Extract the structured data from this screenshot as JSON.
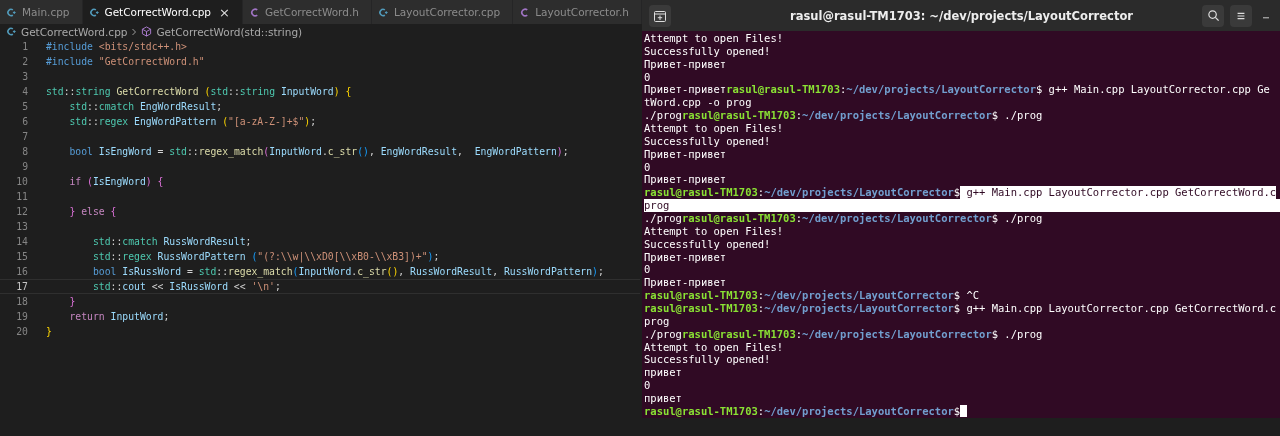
{
  "editor": {
    "tabs": [
      {
        "label": "Main.cpp",
        "kind": "cpp",
        "selected": false
      },
      {
        "label": "GetCorrectWord.cpp",
        "kind": "cpp",
        "selected": true,
        "close": "×"
      },
      {
        "label": "GetCorrectWord.h",
        "kind": "h",
        "selected": false
      },
      {
        "label": "LayoutCorrector.cpp",
        "kind": "cpp",
        "selected": false
      },
      {
        "label": "LayoutCorrector.h",
        "kind": "h",
        "selected": false
      }
    ],
    "breadcrumb": [
      {
        "label": "GetCorrectWord.cpp",
        "kind": "cpp"
      },
      {
        "label": "GetCorrectWord(std::string)",
        "kind": "method"
      }
    ],
    "lines": [
      {
        "n": "1",
        "current": false,
        "tokens": [
          {
            "kind": "pre",
            "text": "#include "
          },
          {
            "kind": "str",
            "text": "<bits/stdc++.h>"
          }
        ]
      },
      {
        "n": "2",
        "current": false,
        "tokens": [
          {
            "kind": "pre",
            "text": "#include "
          },
          {
            "kind": "str",
            "text": "\"GetCorrectWord.h\""
          }
        ]
      },
      {
        "n": "3",
        "current": false
      },
      {
        "n": "4",
        "current": false,
        "tokens": [
          {
            "kind": "type",
            "text": "std"
          },
          {
            "kind": "plain",
            "text": "::"
          },
          {
            "kind": "type",
            "text": "string "
          },
          {
            "kind": "fn",
            "text": "GetCorrectWord "
          },
          {
            "kind": "b1",
            "text": "("
          },
          {
            "kind": "type",
            "text": "std"
          },
          {
            "kind": "plain",
            "text": "::"
          },
          {
            "kind": "type",
            "text": "string "
          },
          {
            "kind": "var",
            "text": "InputWord"
          },
          {
            "kind": "b1",
            "text": ") {"
          }
        ]
      },
      {
        "n": "5",
        "current": false,
        "tokens": [
          {
            "kind": "type",
            "text": "    std"
          },
          {
            "kind": "plain",
            "text": "::"
          },
          {
            "kind": "type",
            "text": "cmatch "
          },
          {
            "kind": "var",
            "text": "EngWordResult"
          },
          {
            "kind": "plain",
            "text": ";"
          }
        ]
      },
      {
        "n": "6",
        "current": false,
        "tokens": [
          {
            "kind": "type",
            "text": "    std"
          },
          {
            "kind": "plain",
            "text": "::"
          },
          {
            "kind": "type",
            "text": "regex "
          },
          {
            "kind": "var",
            "text": "EngWordPattern "
          },
          {
            "kind": "b1",
            "text": "("
          },
          {
            "kind": "str",
            "text": "\"[a-zA-Z-]+$\""
          },
          {
            "kind": "b1",
            "text": ")"
          },
          {
            "kind": "plain",
            "text": ";"
          }
        ]
      },
      {
        "n": "7",
        "current": false
      },
      {
        "n": "8",
        "current": false,
        "tokens": [
          {
            "kind": "kw",
            "text": "    bool "
          },
          {
            "kind": "var",
            "text": "IsEngWord"
          },
          {
            "kind": "plain",
            "text": " = "
          },
          {
            "kind": "type",
            "text": "std"
          },
          {
            "kind": "plain",
            "text": "::"
          },
          {
            "kind": "fn",
            "text": "regex_match"
          },
          {
            "kind": "b2",
            "text": "("
          },
          {
            "kind": "var",
            "text": "InputWord"
          },
          {
            "kind": "plain",
            "text": "."
          },
          {
            "kind": "fn",
            "text": "c_str"
          },
          {
            "kind": "b3",
            "text": "()"
          },
          {
            "kind": "plain",
            "text": ", "
          },
          {
            "kind": "var",
            "text": "EngWordResult"
          },
          {
            "kind": "plain",
            "text": ",  "
          },
          {
            "kind": "var",
            "text": "EngWordPattern"
          },
          {
            "kind": "b2",
            "text": ")"
          },
          {
            "kind": "plain",
            "text": ";"
          }
        ]
      },
      {
        "n": "9",
        "current": false
      },
      {
        "n": "10",
        "current": false,
        "tokens": [
          {
            "kind": "ctl",
            "text": "    if "
          },
          {
            "kind": "b2",
            "text": "("
          },
          {
            "kind": "var",
            "text": "IsEngWord"
          },
          {
            "kind": "b2",
            "text": ") {"
          }
        ]
      },
      {
        "n": "11",
        "current": false
      },
      {
        "n": "12",
        "current": false,
        "tokens": [
          {
            "kind": "b2",
            "text": "    } "
          },
          {
            "kind": "ctl",
            "text": "else "
          },
          {
            "kind": "b2m",
            "text": "{"
          }
        ]
      },
      {
        "n": "13",
        "current": false
      },
      {
        "n": "14",
        "current": false,
        "tokens": [
          {
            "kind": "type",
            "text": "        std"
          },
          {
            "kind": "plain",
            "text": "::"
          },
          {
            "kind": "type",
            "text": "cmatch "
          },
          {
            "kind": "var",
            "text": "RussWordResult"
          },
          {
            "kind": "plain",
            "text": ";"
          }
        ]
      },
      {
        "n": "15",
        "current": false,
        "tokens": [
          {
            "kind": "type",
            "text": "        std"
          },
          {
            "kind": "plain",
            "text": "::"
          },
          {
            "kind": "type",
            "text": "regex "
          },
          {
            "kind": "var",
            "text": "RussWordPattern "
          },
          {
            "kind": "b3",
            "text": "("
          },
          {
            "kind": "str",
            "text": "\"(?:\\\\w|\\\\xD0[\\\\xB0-\\\\xB3])+\""
          },
          {
            "kind": "b3",
            "text": ")"
          },
          {
            "kind": "plain",
            "text": ";"
          }
        ]
      },
      {
        "n": "16",
        "current": false,
        "tokens": [
          {
            "kind": "kw",
            "text": "        bool "
          },
          {
            "kind": "var",
            "text": "IsRussWord"
          },
          {
            "kind": "plain",
            "text": " = "
          },
          {
            "kind": "type",
            "text": "std"
          },
          {
            "kind": "plain",
            "text": "::"
          },
          {
            "kind": "fn",
            "text": "regex_match"
          },
          {
            "kind": "b3",
            "text": "("
          },
          {
            "kind": "var",
            "text": "InputWord"
          },
          {
            "kind": "plain",
            "text": "."
          },
          {
            "kind": "fn",
            "text": "c_str"
          },
          {
            "kind": "b1",
            "text": "()"
          },
          {
            "kind": "plain",
            "text": ", "
          },
          {
            "kind": "var",
            "text": "RussWordResult"
          },
          {
            "kind": "plain",
            "text": ", "
          },
          {
            "kind": "var",
            "text": "RussWordPattern"
          },
          {
            "kind": "b3",
            "text": ")"
          },
          {
            "kind": "plain",
            "text": ";"
          }
        ]
      },
      {
        "n": "17",
        "current": true,
        "tokens": [
          {
            "kind": "type",
            "text": "        std"
          },
          {
            "kind": "plain",
            "text": "::"
          },
          {
            "kind": "var",
            "text": "cout"
          },
          {
            "kind": "plain",
            "text": " << "
          },
          {
            "kind": "var",
            "text": "IsRussWord"
          },
          {
            "kind": "plain",
            "text": " << "
          },
          {
            "kind": "str",
            "text": "'\\n'"
          },
          {
            "kind": "plain",
            "text": ";"
          }
        ]
      },
      {
        "n": "18",
        "current": false,
        "tokens": [
          {
            "kind": "b2m",
            "text": "    }"
          }
        ]
      },
      {
        "n": "19",
        "current": false,
        "tokens": [
          {
            "kind": "ctl",
            "text": "    return "
          },
          {
            "kind": "var",
            "text": "InputWord"
          },
          {
            "kind": "plain",
            "text": ";"
          }
        ]
      },
      {
        "n": "20",
        "current": false,
        "tokens": [
          {
            "kind": "b1",
            "text": "}"
          }
        ]
      }
    ]
  },
  "terminal": {
    "title": "rasul@rasul-TM1703: ~/dev/projects/LayoutCorrector",
    "lines": [
      {
        "selected": false,
        "segments": [
          {
            "kind": "out",
            "text": "Attempt to open Files!"
          }
        ]
      },
      {
        "selected": false,
        "segments": [
          {
            "kind": "out",
            "text": "Successfully opened!"
          }
        ]
      },
      {
        "selected": false,
        "segments": [
          {
            "kind": "out",
            "text": "Привет-привет"
          }
        ]
      },
      {
        "selected": false,
        "segments": [
          {
            "kind": "out",
            "text": "0"
          }
        ]
      },
      {
        "selected": false,
        "segments": [
          {
            "kind": "out",
            "text": "Привет-привет"
          },
          {
            "kind": "user",
            "text": "rasul@rasul-TM1703"
          },
          {
            "kind": "out",
            "text": ":"
          },
          {
            "kind": "path",
            "text": "~/dev/projects/LayoutCorrector"
          },
          {
            "kind": "out",
            "text": "$ g++ Main.cpp LayoutCorrector.cpp Ge"
          }
        ]
      },
      {
        "selected": false,
        "segments": [
          {
            "kind": "out",
            "text": "tWord.cpp -o prog"
          }
        ]
      },
      {
        "selected": false,
        "segments": [
          {
            "kind": "out",
            "text": "./prog"
          },
          {
            "kind": "user",
            "text": "rasul@rasul-TM1703"
          },
          {
            "kind": "out",
            "text": ":"
          },
          {
            "kind": "path",
            "text": "~/dev/projects/LayoutCorrector"
          },
          {
            "kind": "out",
            "text": "$ ./prog"
          }
        ]
      },
      {
        "selected": false,
        "segments": [
          {
            "kind": "out",
            "text": "Attempt to open Files!"
          }
        ]
      },
      {
        "selected": false,
        "segments": [
          {
            "kind": "out",
            "text": "Successfully opened!"
          }
        ]
      },
      {
        "selected": false,
        "segments": [
          {
            "kind": "out",
            "text": "Привет-привет"
          }
        ]
      },
      {
        "selected": false,
        "segments": [
          {
            "kind": "out",
            "text": "0"
          }
        ]
      },
      {
        "selected": false,
        "segments": [
          {
            "kind": "out",
            "text": "Привет-привет"
          }
        ]
      },
      {
        "selected": false,
        "segments": [
          {
            "kind": "user",
            "text": "rasul@rasul-TM1703"
          },
          {
            "kind": "out",
            "text": ":"
          },
          {
            "kind": "path",
            "text": "~/dev/projects/LayoutCorrector"
          },
          {
            "kind": "out",
            "text": "$"
          },
          {
            "kind": "sel",
            "text": " g++ Main.cpp LayoutCorrector.cpp GetCorrectWord.c"
          }
        ]
      },
      {
        "selected": true,
        "segments": [
          {
            "kind": "out",
            "text": "prog"
          }
        ]
      },
      {
        "selected": false,
        "segments": [
          {
            "kind": "out",
            "text": "./prog"
          },
          {
            "kind": "user",
            "text": "rasul@rasul-TM1703"
          },
          {
            "kind": "out",
            "text": ":"
          },
          {
            "kind": "path",
            "text": "~/dev/projects/LayoutCorrector"
          },
          {
            "kind": "out",
            "text": "$ ./prog"
          }
        ]
      },
      {
        "selected": false,
        "segments": [
          {
            "kind": "out",
            "text": "Attempt to open Files!"
          }
        ]
      },
      {
        "selected": false,
        "segments": [
          {
            "kind": "out",
            "text": "Successfully opened!"
          }
        ]
      },
      {
        "selected": false,
        "segments": [
          {
            "kind": "out",
            "text": "Привет-привет"
          }
        ]
      },
      {
        "selected": false,
        "segments": [
          {
            "kind": "out",
            "text": "0"
          }
        ]
      },
      {
        "selected": false,
        "segments": [
          {
            "kind": "out",
            "text": "Привет-привет"
          }
        ]
      },
      {
        "selected": false,
        "segments": [
          {
            "kind": "user",
            "text": "rasul@rasul-TM1703"
          },
          {
            "kind": "out",
            "text": ":"
          },
          {
            "kind": "path",
            "text": "~/dev/projects/LayoutCorrector"
          },
          {
            "kind": "out",
            "text": "$ ^C"
          }
        ]
      },
      {
        "selected": false,
        "segments": [
          {
            "kind": "user",
            "text": "rasul@rasul-TM1703"
          },
          {
            "kind": "out",
            "text": ":"
          },
          {
            "kind": "path",
            "text": "~/dev/projects/LayoutCorrector"
          },
          {
            "kind": "out",
            "text": "$ g++ Main.cpp LayoutCorrector.cpp GetCorrectWord.c"
          }
        ]
      },
      {
        "selected": false,
        "segments": [
          {
            "kind": "out",
            "text": "prog"
          }
        ]
      },
      {
        "selected": false,
        "segments": [
          {
            "kind": "out",
            "text": "./prog"
          },
          {
            "kind": "user",
            "text": "rasul@rasul-TM1703"
          },
          {
            "kind": "out",
            "text": ":"
          },
          {
            "kind": "path",
            "text": "~/dev/projects/LayoutCorrector"
          },
          {
            "kind": "out",
            "text": "$ ./prog"
          }
        ]
      },
      {
        "selected": false,
        "segments": [
          {
            "kind": "out",
            "text": "Attempt to open Files!"
          }
        ]
      },
      {
        "selected": false,
        "segments": [
          {
            "kind": "out",
            "text": "Successfully opened!"
          }
        ]
      },
      {
        "selected": false,
        "segments": [
          {
            "kind": "out",
            "text": "привет"
          }
        ]
      },
      {
        "selected": false,
        "segments": [
          {
            "kind": "out",
            "text": "0"
          }
        ]
      },
      {
        "selected": false,
        "segments": [
          {
            "kind": "out",
            "text": "привет"
          }
        ]
      },
      {
        "selected": false,
        "cursor": true,
        "segments": [
          {
            "kind": "user",
            "text": "rasul@rasul-TM1703"
          },
          {
            "kind": "out",
            "text": ":"
          },
          {
            "kind": "path",
            "text": "~/dev/projects/LayoutCorrector"
          },
          {
            "kind": "out",
            "text": "$"
          }
        ]
      }
    ]
  }
}
